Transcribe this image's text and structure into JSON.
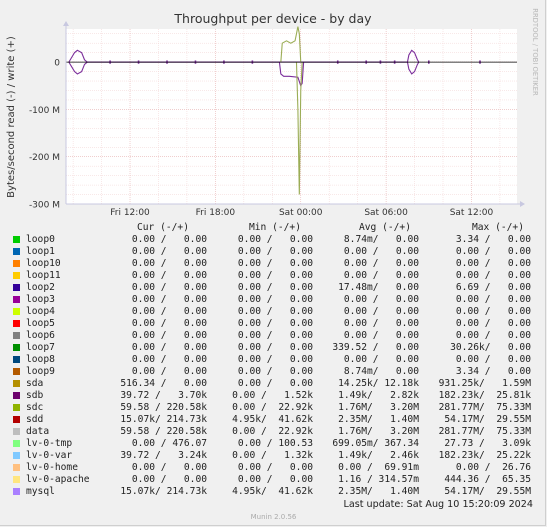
{
  "chart_data": {
    "type": "line",
    "title": "Throughput per device - by day",
    "ylabel": "Bytes/second read (-) / write (+)",
    "side_label": "RRDTOOL / TOBI OETIKER",
    "ylim": [
      -300000000,
      70000000
    ],
    "y_ticks": [
      {
        "value": 0,
        "label": "0"
      },
      {
        "value": -100000000,
        "label": "-100 M"
      },
      {
        "value": -200000000,
        "label": "-200 M"
      },
      {
        "value": -300000000,
        "label": "-300 M"
      }
    ],
    "x_ticks": [
      {
        "hour": 12,
        "label": "Fri 12:00"
      },
      {
        "hour": 18,
        "label": "Fri 18:00"
      },
      {
        "hour": 24,
        "label": "Sat 00:00"
      },
      {
        "hour": 30,
        "label": "Sat 06:00"
      },
      {
        "hour": 36,
        "label": "Sat 12:00"
      }
    ],
    "x_range_hours": [
      7.5,
      39.2
    ],
    "series": [
      {
        "name": "sdb",
        "color": "#7b2e9b",
        "mode": "write",
        "points": [
          [
            7.7,
            0
          ],
          [
            7.9,
            10000000
          ],
          [
            8.1,
            20000000
          ],
          [
            8.3,
            25000000
          ],
          [
            8.6,
            20000000
          ],
          [
            8.8,
            5000000
          ],
          [
            9.0,
            0
          ],
          [
            31.5,
            0
          ],
          [
            31.6,
            15000000
          ],
          [
            31.8,
            25000000
          ],
          [
            32.0,
            20000000
          ],
          [
            32.2,
            5000000
          ],
          [
            32.3,
            0
          ]
        ]
      },
      {
        "name": "sdb",
        "color": "#7b2e9b",
        "mode": "read",
        "points": [
          [
            7.7,
            0
          ],
          [
            7.9,
            -10000000
          ],
          [
            8.1,
            -20000000
          ],
          [
            8.3,
            -25000000
          ],
          [
            8.6,
            -20000000
          ],
          [
            8.8,
            -5000000
          ],
          [
            9.0,
            0
          ],
          [
            22.5,
            0
          ],
          [
            22.6,
            -25000000
          ],
          [
            22.8,
            -30000000
          ],
          [
            23.2,
            -30000000
          ],
          [
            23.8,
            -32000000
          ],
          [
            24.0,
            -50000000
          ],
          [
            24.1,
            -45000000
          ],
          [
            24.2,
            0
          ],
          [
            31.5,
            0
          ],
          [
            31.6,
            -15000000
          ],
          [
            31.8,
            -25000000
          ],
          [
            32.0,
            -20000000
          ],
          [
            32.2,
            -5000000
          ],
          [
            32.3,
            0
          ]
        ]
      },
      {
        "name": "sdc",
        "color": "#9bad56",
        "mode": "write",
        "points": [
          [
            22.6,
            0
          ],
          [
            22.7,
            40000000
          ],
          [
            23.0,
            45000000
          ],
          [
            23.3,
            40000000
          ],
          [
            23.6,
            45000000
          ],
          [
            23.8,
            75000000
          ],
          [
            23.9,
            60000000
          ],
          [
            24.0,
            0
          ]
        ]
      },
      {
        "name": "sdc",
        "color": "#9bad56",
        "mode": "read",
        "points": [
          [
            23.7,
            0
          ],
          [
            23.8,
            -100000000
          ],
          [
            23.9,
            -280000000
          ],
          [
            24.0,
            -60000000
          ],
          [
            24.1,
            0
          ]
        ]
      },
      {
        "name": "loop devices",
        "color": "#7b2e9b",
        "mode": "spikes",
        "points": [
          [
            10.6,
            0
          ],
          [
            12.6,
            0
          ],
          [
            14.6,
            0
          ],
          [
            16.6,
            0
          ],
          [
            18.6,
            0
          ],
          [
            20.6,
            0
          ],
          [
            26.6,
            0
          ],
          [
            28.6,
            0
          ],
          [
            29.6,
            0
          ],
          [
            30.6,
            0
          ],
          [
            33.0,
            0
          ],
          [
            36.6,
            0
          ]
        ]
      }
    ]
  },
  "legend": {
    "headers": {
      "cur": "Cur (-/+)",
      "min": "Min (-/+)",
      "avg": "Avg (-/+)",
      "max": "Max (-/+)"
    },
    "rows": [
      {
        "name": "loop0",
        "color": "#00cc00",
        "cur": "0.00 /   0.00",
        "min": "0.00 /   0.00",
        "avg": "8.74m/   0.00",
        "max": "3.34 /   0.00"
      },
      {
        "name": "loop1",
        "color": "#0066b3",
        "cur": "0.00 /   0.00",
        "min": "0.00 /   0.00",
        "avg": "0.00 /   0.00",
        "max": "0.00 /   0.00"
      },
      {
        "name": "loop10",
        "color": "#ff8000",
        "cur": "0.00 /   0.00",
        "min": "0.00 /   0.00",
        "avg": "0.00 /   0.00",
        "max": "0.00 /   0.00"
      },
      {
        "name": "loop11",
        "color": "#ffcc00",
        "cur": "0.00 /   0.00",
        "min": "0.00 /   0.00",
        "avg": "0.00 /   0.00",
        "max": "0.00 /   0.00"
      },
      {
        "name": "loop2",
        "color": "#330099",
        "cur": "0.00 /   0.00",
        "min": "0.00 /   0.00",
        "avg": "17.48m/   0.00",
        "max": "6.69 /   0.00"
      },
      {
        "name": "loop3",
        "color": "#990099",
        "cur": "0.00 /   0.00",
        "min": "0.00 /   0.00",
        "avg": "0.00 /   0.00",
        "max": "0.00 /   0.00"
      },
      {
        "name": "loop4",
        "color": "#ccff00",
        "cur": "0.00 /   0.00",
        "min": "0.00 /   0.00",
        "avg": "0.00 /   0.00",
        "max": "0.00 /   0.00"
      },
      {
        "name": "loop5",
        "color": "#ff0000",
        "cur": "0.00 /   0.00",
        "min": "0.00 /   0.00",
        "avg": "0.00 /   0.00",
        "max": "0.00 /   0.00"
      },
      {
        "name": "loop6",
        "color": "#808080",
        "cur": "0.00 /   0.00",
        "min": "0.00 /   0.00",
        "avg": "0.00 /   0.00",
        "max": "0.00 /   0.00"
      },
      {
        "name": "loop7",
        "color": "#008f00",
        "cur": "0.00 /   0.00",
        "min": "0.00 /   0.00",
        "avg": "339.52 /   0.00",
        "max": "30.26k/   0.00"
      },
      {
        "name": "loop8",
        "color": "#00487d",
        "cur": "0.00 /   0.00",
        "min": "0.00 /   0.00",
        "avg": "0.00 /   0.00",
        "max": "0.00 /   0.00"
      },
      {
        "name": "loop9",
        "color": "#b35a00",
        "cur": "0.00 /   0.00",
        "min": "0.00 /   0.00",
        "avg": "8.74m/   0.00",
        "max": "3.34 /   0.00"
      },
      {
        "name": "sda",
        "color": "#b38f00",
        "cur": "516.34 /   0.00",
        "min": "0.00 /   0.00",
        "avg": "14.25k/ 12.18k",
        "max": "931.25k/   1.59M"
      },
      {
        "name": "sdb",
        "color": "#6b006b",
        "cur": "39.72 /   3.70k",
        "min": "0.00 /   1.52k",
        "avg": "1.49k/   2.82k",
        "max": "182.23k/  25.81k"
      },
      {
        "name": "sdc",
        "color": "#8fb300",
        "cur": "59.58 / 220.58k",
        "min": "0.00 /  22.92k",
        "avg": "1.76M/   3.20M",
        "max": "281.77M/  75.33M"
      },
      {
        "name": "sdd",
        "color": "#b30000",
        "cur": "15.07k/ 214.73k",
        "min": "4.95k/  41.62k",
        "avg": "2.35M/   1.40M",
        "max": "54.17M/  29.55M"
      },
      {
        "name": "data",
        "color": "#bebebe",
        "cur": "59.58 / 220.58k",
        "min": "0.00 /  22.92k",
        "avg": "1.76M/   3.20M",
        "max": "281.77M/  75.33M"
      },
      {
        "name": "lv-0-tmp",
        "color": "#80ff80",
        "cur": "0.00 / 476.07",
        "min": "0.00 / 100.53",
        "avg": "699.05m/ 367.34",
        "max": "27.73 /   3.09k"
      },
      {
        "name": "lv-0-var",
        "color": "#80c9ff",
        "cur": "39.72 /   3.24k",
        "min": "0.00 /   1.32k",
        "avg": "1.49k/   2.46k",
        "max": "182.23k/  25.22k"
      },
      {
        "name": "lv-0-home",
        "color": "#ffc080",
        "cur": "0.00 /   0.00",
        "min": "0.00 /   0.00",
        "avg": "0.00 /  69.91m",
        "max": "0.00 /  26.76"
      },
      {
        "name": "lv-0-apache",
        "color": "#ffe680",
        "cur": "0.00 /   0.00",
        "min": "0.00 /   0.00",
        "avg": "1.16 / 314.57m",
        "max": "444.36 /  65.35"
      },
      {
        "name": "mysql",
        "color": "#aa80ff",
        "cur": "15.07k/ 214.73k",
        "min": "4.95k/  41.62k",
        "avg": "2.35M/   1.40M",
        "max": "54.17M/  29.55M"
      }
    ]
  },
  "last_update": "Last update: Sat Aug 10 15:20:09 2024",
  "footer": "Munin 2.0.56"
}
